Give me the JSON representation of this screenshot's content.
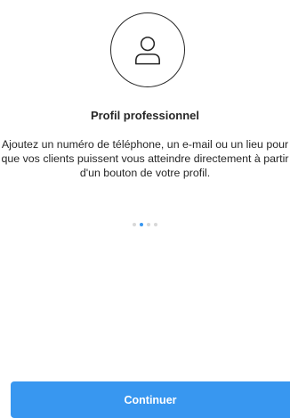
{
  "screen": {
    "title": "Profil professionnel",
    "description": "Ajoutez un numéro de téléphone, un e-mail ou un lieu pour que vos clients puissent vous atteindre directement à partir d'un bouton de votre profil.",
    "avatar_icon": "user-outline-icon",
    "pagination": {
      "total": 4,
      "active_index": 1
    },
    "continue_label": "Continuer"
  },
  "colors": {
    "accent": "#3897f0",
    "text": "#262626",
    "dot_inactive": "#d8d8d8",
    "background": "#ffffff"
  }
}
